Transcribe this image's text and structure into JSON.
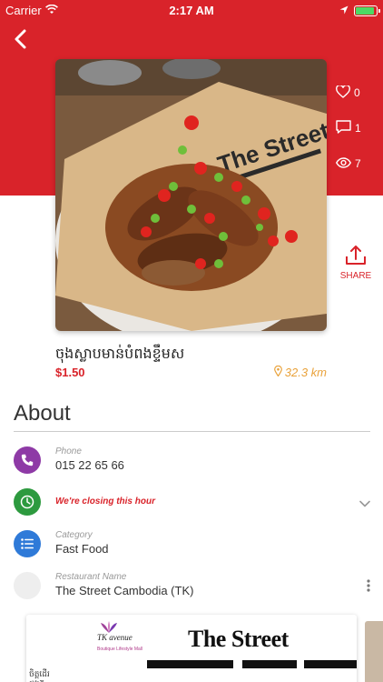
{
  "status_bar": {
    "carrier": "Carrier",
    "time": "2:17 AM",
    "icons": [
      "wifi-icon",
      "location-arrow-icon",
      "battery-icon"
    ],
    "battery_color": "#4cd964"
  },
  "colors": {
    "brand_red": "#d9232a",
    "distance_orange": "#e9a23b",
    "phone_icon_bg": "#8e3aa6",
    "clock_icon_bg": "#2d9a3f",
    "category_icon_bg": "#2f7ad8",
    "restaurant_icon_bg": "#eeeeee"
  },
  "nav": {
    "back_icon": "chevron-left-icon"
  },
  "stats": {
    "likes": "0",
    "comments": "1",
    "views": "7"
  },
  "share": {
    "label": "SHARE",
    "icon": "share-upload-icon"
  },
  "dish": {
    "name": "ចុងស្លាបមាន់បំពងខ្ទឹមស",
    "price": "$1.50",
    "distance": "32.3 km"
  },
  "about": {
    "title": "About",
    "phone": {
      "label": "Phone",
      "value": "015 22 65 66"
    },
    "hours": {
      "status": "We're closing this hour"
    },
    "category": {
      "label": "Category",
      "value": "Fast Food"
    },
    "restaurant": {
      "label": "Restaurant Name",
      "value": "The Street Cambodia (TK)"
    }
  },
  "banner": {
    "logo_text": "The Street",
    "tk_text": "TK avenue",
    "tk_sub": "Boutique Lifestyle Mall",
    "side_text": "ចិត្តដើរ\nផ្លូវហ៊ុ"
  }
}
